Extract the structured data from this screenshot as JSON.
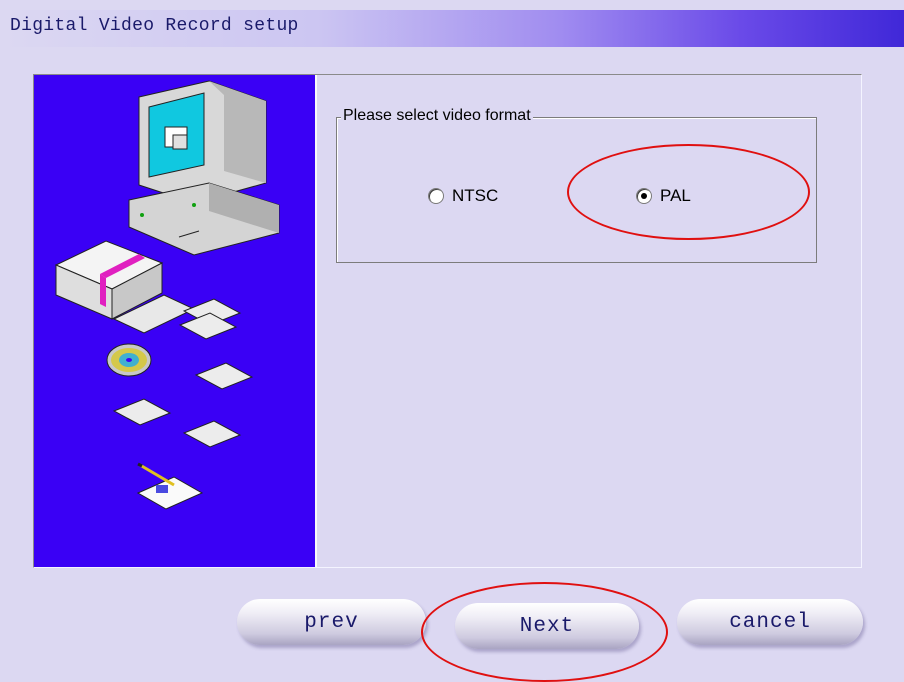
{
  "window": {
    "title": "Digital Video Record setup"
  },
  "format_group": {
    "legend": "Please select video format",
    "options": [
      {
        "label": "NTSC",
        "selected": false
      },
      {
        "label": "PAL",
        "selected": true
      }
    ]
  },
  "buttons": {
    "prev": "prev",
    "next": "Next",
    "cancel": "cancel"
  },
  "annotations": {
    "color": "#e01010"
  },
  "illustration": {
    "background": "#3a00f5"
  }
}
